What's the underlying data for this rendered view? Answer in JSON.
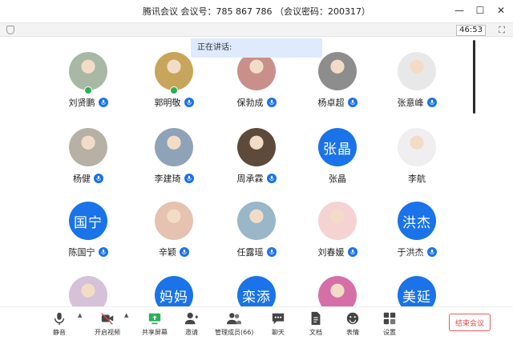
{
  "window": {
    "title": "腾讯会议 会议号：785 867 786 （会议密码：200317）"
  },
  "timer": "46:53",
  "speaking_label": "正在讲话:",
  "participants": [
    {
      "name": "刘贤鹏",
      "initial": "",
      "photo": "#a9b8a5"
    },
    {
      "name": "郭明敬",
      "initial": "",
      "photo": "#c7a55a"
    },
    {
      "name": "保勃成",
      "initial": "",
      "photo": "#c98f8a"
    },
    {
      "name": "杨卓超",
      "initial": "",
      "photo": "#8d8d8d"
    },
    {
      "name": "张意峰",
      "initial": "",
      "photo": "#e8e8e8"
    },
    {
      "name": "杨健",
      "initial": "",
      "photo": "#b7b1a5"
    },
    {
      "name": "李建琦",
      "initial": "",
      "photo": "#8fa3b8"
    },
    {
      "name": "周承霖",
      "initial": "",
      "photo": "#5d4a3a"
    },
    {
      "name": "张晶",
      "initial": "张晶",
      "photo": ""
    },
    {
      "name": "李航",
      "initial": "",
      "photo": "#f0eef0"
    },
    {
      "name": "陈国宁",
      "initial": "国宁",
      "photo": ""
    },
    {
      "name": "辛颖",
      "initial": "",
      "photo": "#e6c2b0"
    },
    {
      "name": "任露瑶",
      "initial": "",
      "photo": "#9ab6c9"
    },
    {
      "name": "刘春媛",
      "initial": "",
      "photo": "#f6d3d3"
    },
    {
      "name": "于洪杰",
      "initial": "洪杰",
      "photo": ""
    },
    {
      "name": "",
      "initial": "",
      "photo": "#d5c2d8"
    },
    {
      "name": "",
      "initial": "妈妈",
      "photo": ""
    },
    {
      "name": "",
      "initial": "栾添",
      "photo": ""
    },
    {
      "name": "",
      "initial": "",
      "photo": "#d66fa8"
    },
    {
      "name": "",
      "initial": "美延",
      "photo": ""
    }
  ],
  "toolbar": {
    "mute": "静音",
    "video": "开启视频",
    "share": "共享屏幕",
    "invite": "邀请",
    "members": "管理成员(66)",
    "chat": "聊天",
    "docs": "文档",
    "emoji": "表情",
    "settings": "设置",
    "end": "结束会议"
  },
  "colors": {
    "accent": "#1a73e8",
    "end": "#e04848",
    "share_green": "#2bb05a"
  }
}
